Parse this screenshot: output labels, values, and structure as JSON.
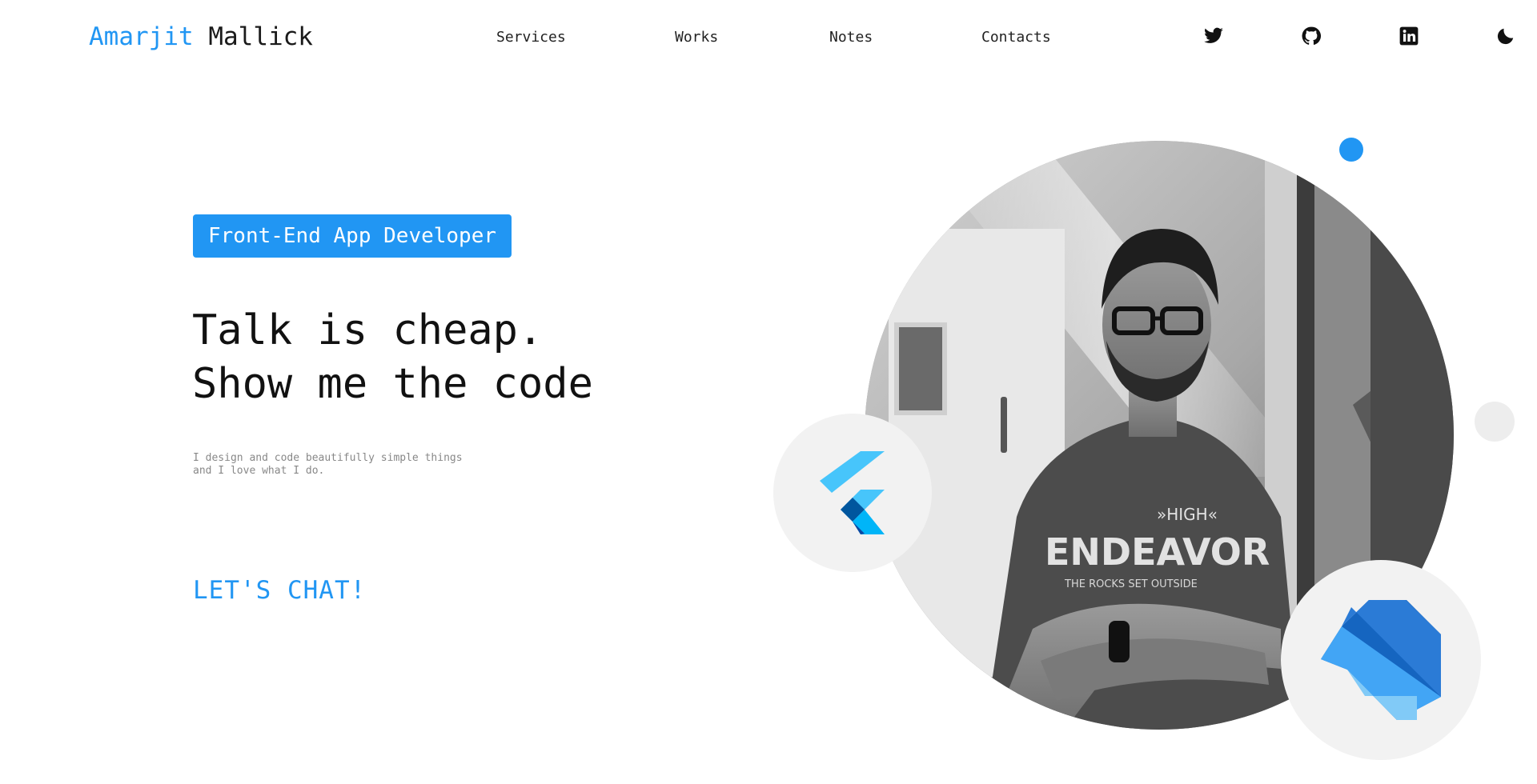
{
  "header": {
    "logo_first": "Amarjit",
    "logo_last": "Mallick",
    "nav": [
      {
        "label": "Services"
      },
      {
        "label": "Works"
      },
      {
        "label": "Notes"
      },
      {
        "label": "Contacts"
      }
    ],
    "social_icons": [
      "twitter-icon",
      "github-icon",
      "linkedin-icon",
      "moon-icon"
    ]
  },
  "hero": {
    "badge": "Front-End App Developer",
    "headline_line1": "Talk is cheap.",
    "headline_line2": "Show me the code",
    "tagline_line1": "I design and code beautifully simple things",
    "tagline_line2": "and I love what I do.",
    "cta": "LET'S CHAT!"
  },
  "colors": {
    "accent": "#2196f3",
    "text": "#111111",
    "muted": "#888888",
    "bubble": "#f2f2f2"
  },
  "icons": {
    "profile": "profile-photo",
    "tech": [
      "flutter-logo-icon",
      "dart-logo-icon"
    ]
  }
}
